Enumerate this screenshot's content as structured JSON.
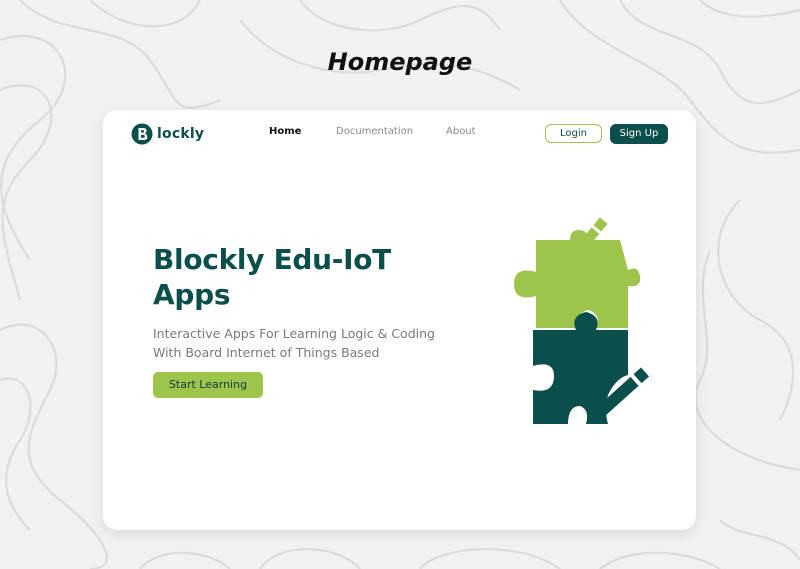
{
  "heading": "Homepage",
  "brand": {
    "name": "lockly"
  },
  "nav": {
    "items": [
      {
        "label": "Home",
        "active": true
      },
      {
        "label": "Documentation",
        "active": false
      },
      {
        "label": "About",
        "active": false
      }
    ],
    "login_label": "Login",
    "signup_label": "Sign Up"
  },
  "hero": {
    "title_line1": "Blockly Edu-IoT",
    "title_line2": "Apps",
    "subtitle_line1": "Interactive Apps For Learning Logic & Coding",
    "subtitle_line2": "With Board Internet of Things Based",
    "cta_label": "Start Learning"
  },
  "colors": {
    "primary": "#0b4f4c",
    "accent": "#9ec44b",
    "background": "#f2f2f2"
  },
  "illustration": {
    "icons": [
      "puzzle-piece-icon",
      "pencil-icon"
    ]
  }
}
